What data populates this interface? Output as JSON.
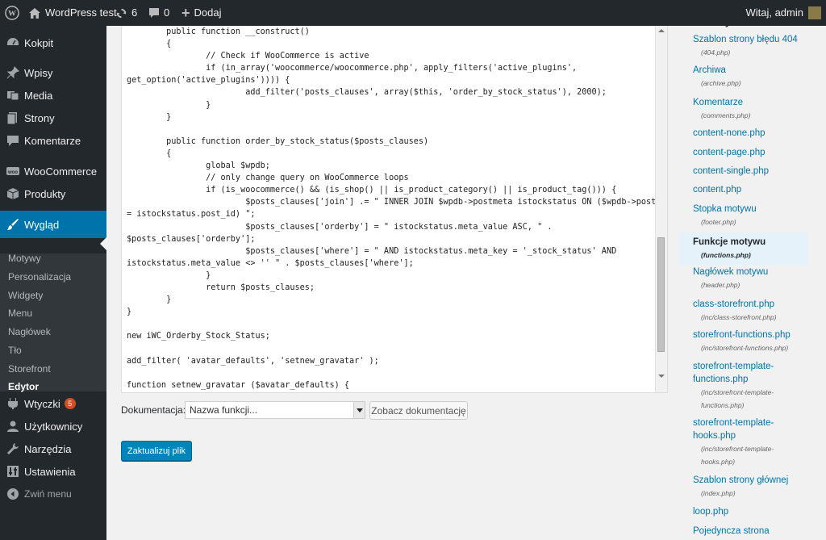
{
  "admin_bar": {
    "site_name": "WordPress test",
    "updates_count": "6",
    "comments_count": "0",
    "new_label": "Dodaj",
    "greeting": "Witaj, admin"
  },
  "sidebar": {
    "items": [
      {
        "label": "Kokpit",
        "icon": "dashboard-icon"
      },
      {
        "label": "Wpisy",
        "icon": "pushpin-icon"
      },
      {
        "label": "Media",
        "icon": "media-icon"
      },
      {
        "label": "Strony",
        "icon": "pages-icon"
      },
      {
        "label": "Komentarze",
        "icon": "comment-icon"
      },
      {
        "label": "WooCommerce",
        "icon": "woocommerce-icon"
      },
      {
        "label": "Produkty",
        "icon": "box-icon"
      },
      {
        "label": "Wygląd",
        "icon": "brush-icon"
      },
      {
        "label": "Wtyczki",
        "icon": "plugin-icon",
        "badge": "5"
      },
      {
        "label": "Użytkownicy",
        "icon": "users-icon"
      },
      {
        "label": "Narzędzia",
        "icon": "wrench-icon"
      },
      {
        "label": "Ustawienia",
        "icon": "settings-icon"
      },
      {
        "label": "Zwiń menu",
        "icon": "collapse-icon"
      }
    ],
    "submenu": [
      "Motywy",
      "Personalizacja",
      "Widgety",
      "Menu",
      "Nagłówek",
      "Tło",
      "Storefront",
      "Edytor"
    ],
    "active_submenu": "Edytor"
  },
  "editor": {
    "code": "        public function __construct()\n        {\n                // Check if WooCommerce is active\n                if (in_array('woocommerce/woocommerce.php', apply_filters('active_plugins',\nget_option('active_plugins')))) {\n                        add_filter('posts_clauses', array($this, 'order_by_stock_status'), 2000);\n                }\n        }\n\n        public function order_by_stock_status($posts_clauses)\n        {\n                global $wpdb;\n                // only change query on WooCommerce loops\n                if (is_woocommerce() && (is_shop() || is_product_category() || is_product_tag())) {\n                        $posts_clauses['join'] .= \" INNER JOIN $wpdb->postmeta istockstatus ON ($wpdb->posts.ID\n= istockstatus.post_id) \";\n                        $posts_clauses['orderby'] = \" istockstatus.meta_value ASC, \" .\n$posts_clauses['orderby'];\n                        $posts_clauses['where'] = \" AND istockstatus.meta_key = '_stock_status' AND\nistockstatus.meta_value <> '' \" . $posts_clauses['where'];\n                }\n                return $posts_clauses;\n        }\n}\n\nnew iWC_Orderby_Stock_Status;\n\nadd_filter( 'avatar_defaults', 'setnew_gravatar' );\n\nfunction setnew_gravatar ($avatar_defaults) {"
  },
  "documentation": {
    "label": "Dokumentacja:",
    "select_value": "Nazwa funkcji...",
    "lookup_button": "Zobacz dokumentację"
  },
  "update_button": "Zaktualizuj plik",
  "files": {
    "header": "Szablony",
    "items": [
      {
        "name": "Szablon strony błędu 404",
        "file": "(404.php)"
      },
      {
        "name": "Archiwa",
        "file": "(archive.php)"
      },
      {
        "name": "Komentarze",
        "file": "(comments.php)"
      },
      {
        "name": "content-none.php",
        "file": ""
      },
      {
        "name": "content-page.php",
        "file": ""
      },
      {
        "name": "content-single.php",
        "file": ""
      },
      {
        "name": "content.php",
        "file": ""
      },
      {
        "name": "Stopka motywu",
        "file": "(footer.php)"
      },
      {
        "name": "Funkcje motywu",
        "file": "(functions.php)"
      },
      {
        "name": "Nagłówek motywu",
        "file": "(header.php)"
      },
      {
        "name": "class-storefront.php",
        "file": "(inc/class-storefront.php)"
      },
      {
        "name": "storefront-functions.php",
        "file": "(inc/storefront-functions.php)"
      },
      {
        "name": "storefront-template-functions.php",
        "file": "(inc/storefront-template-functions.php)"
      },
      {
        "name": "storefront-template-hooks.php",
        "file": "(inc/storefront-template-hooks.php)"
      },
      {
        "name": "Szablon strony głównej",
        "file": "(index.php)"
      },
      {
        "name": "loop.php",
        "file": ""
      },
      {
        "name": "Pojedyncza strona",
        "file": ""
      }
    ],
    "selected": "Funkcje motywu"
  },
  "colors": {
    "admin_dark": "#23282d",
    "accent_blue": "#0073aa",
    "button_blue": "#0085ba",
    "badge_orange": "#d54e21"
  }
}
